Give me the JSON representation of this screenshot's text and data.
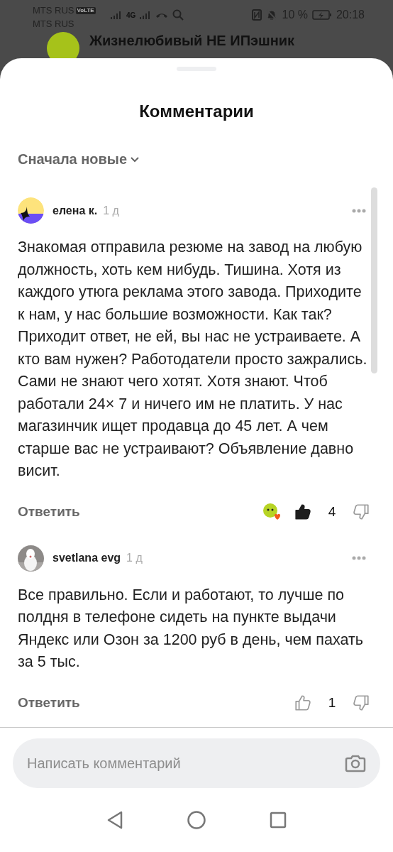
{
  "status_bar": {
    "carrier_1": "MTS RUS",
    "volte": "VoLTE",
    "carrier_2": "MTS RUS",
    "network": "4G",
    "battery": "10 %",
    "time": "20:18"
  },
  "channel": {
    "title": "Жизнелюбивый НЕ ИПэшник"
  },
  "sheet": {
    "title": "Комментарии",
    "sort": "Сначала новые"
  },
  "comments": [
    {
      "author": "елена к.",
      "age": "1 д",
      "avatar": {
        "kind": "abstract"
      },
      "text": "Знакомая отправила резюме на завод на любую должность, хоть кем нибудь. Тишина. Хотя из каждого утюга реклама этого завода. Приходите к нам, у нас большие возможности. Как так? Приходит ответ, не ей, вы нас не устраиваете. А кто вам нужен? Работодатели просто зажрались. Сами не знают чего хотят. Хотя знают. Чтоб работали 24× 7 и ничего им не платить. У нас магазинчик ищет продавца до 45 лет. А чем старше вас не устраивают? Объявление давно висит.",
      "reply": "Ответить",
      "reaction": true,
      "liked": true,
      "likes": "4"
    },
    {
      "author": "svetlana evg",
      "age": "1 д",
      "text": "Все правильно. Если и работают, то лучше по полдня в телефоне сидеть на пункте выдачи Яндекс или Озон за 1200 руб в день, чем пахать за 5 тыс.",
      "reply": "Ответить",
      "reaction": false,
      "liked": false,
      "likes": "1"
    }
  ],
  "composer": {
    "placeholder": "Написать комментарий"
  }
}
